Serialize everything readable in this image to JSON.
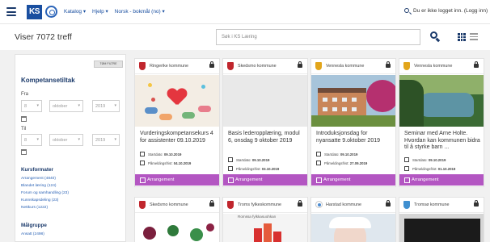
{
  "nav": {
    "logo_text": "KS",
    "items": [
      "Katalog ▾",
      "Hjelp ▾",
      "Norsk - bokmål (no) ▾"
    ],
    "user_text": "Du er ikke logget inn. (Logg inn)"
  },
  "header": {
    "title": "Viser 7072 treff",
    "search_placeholder": "Søk i KS Læring"
  },
  "filters": {
    "reset_label": "TØM FILTRE",
    "title": "Kompetansetiltak",
    "from_label": "Fra",
    "to_label": "Til",
    "from": {
      "day": "8",
      "month": "oktober",
      "year": "2019"
    },
    "to": {
      "day": "8",
      "month": "oktober",
      "year": "2019"
    },
    "course_formats_title": "Kursformater",
    "course_formats": [
      "Arrangement (4840)",
      "Blandet læring (124)",
      "Forum og samhandling (23)",
      "Kunnskapsdeling (23)",
      "Nettkurs (1222)"
    ],
    "target_group_title": "Målgruppe",
    "target_groups": [
      "Ansatt (2498)"
    ]
  },
  "cards": [
    {
      "org": "Ringerike kommune",
      "crest": "red",
      "title": "Vurderingskompetansekurs 4 for assistenter 09.10.2019",
      "start_label": "Startdato:",
      "start": "09.10.2019",
      "deadline_label": "Påmeldingsfrist:",
      "deadline": "04.10.2019",
      "type": "Arrangement"
    },
    {
      "org": "Skedsmo kommune",
      "crest": "red",
      "title": "Basis lederopplæring, modul 6, onsdag 9 oktober 2019",
      "start_label": "Startdato:",
      "start": "09.10.2019",
      "deadline_label": "Påmeldingsfrist:",
      "deadline": "03.10.2019",
      "type": "Arrangement"
    },
    {
      "org": "Vennesla kommune",
      "crest": "yellow",
      "title": "Introduksjonsdag for nyansatte 9.oktober 2019",
      "start_label": "Startdato:",
      "start": "09.10.2019",
      "deadline_label": "Påmeldingsfrist:",
      "deadline": "27.09.2019",
      "type": "Arrangement"
    },
    {
      "org": "Vennesla kommune",
      "crest": "yellow",
      "title": "Seminar med Arne Holte. Hvordan kan kommunen bidra til å styrke barn ...",
      "start_label": "Startdato:",
      "start": "09.10.2019",
      "deadline_label": "Påmeldingsfrist:",
      "deadline": "01.10.2019",
      "type": "Arrangement"
    },
    {
      "org": "Skedsmo kommune",
      "crest": "red"
    },
    {
      "org": "Troms fylkeskommune",
      "crest": "red",
      "subtitle": "Romssa fylkkasuohkan"
    },
    {
      "org": "Harstad kommune",
      "crest": "ring"
    },
    {
      "org": "Tromsø kommune",
      "crest": "blue"
    }
  ],
  "colors": {
    "accent": "#b356c2",
    "nav_blue": "#1b3a6b",
    "link_blue": "#2a62b5"
  }
}
